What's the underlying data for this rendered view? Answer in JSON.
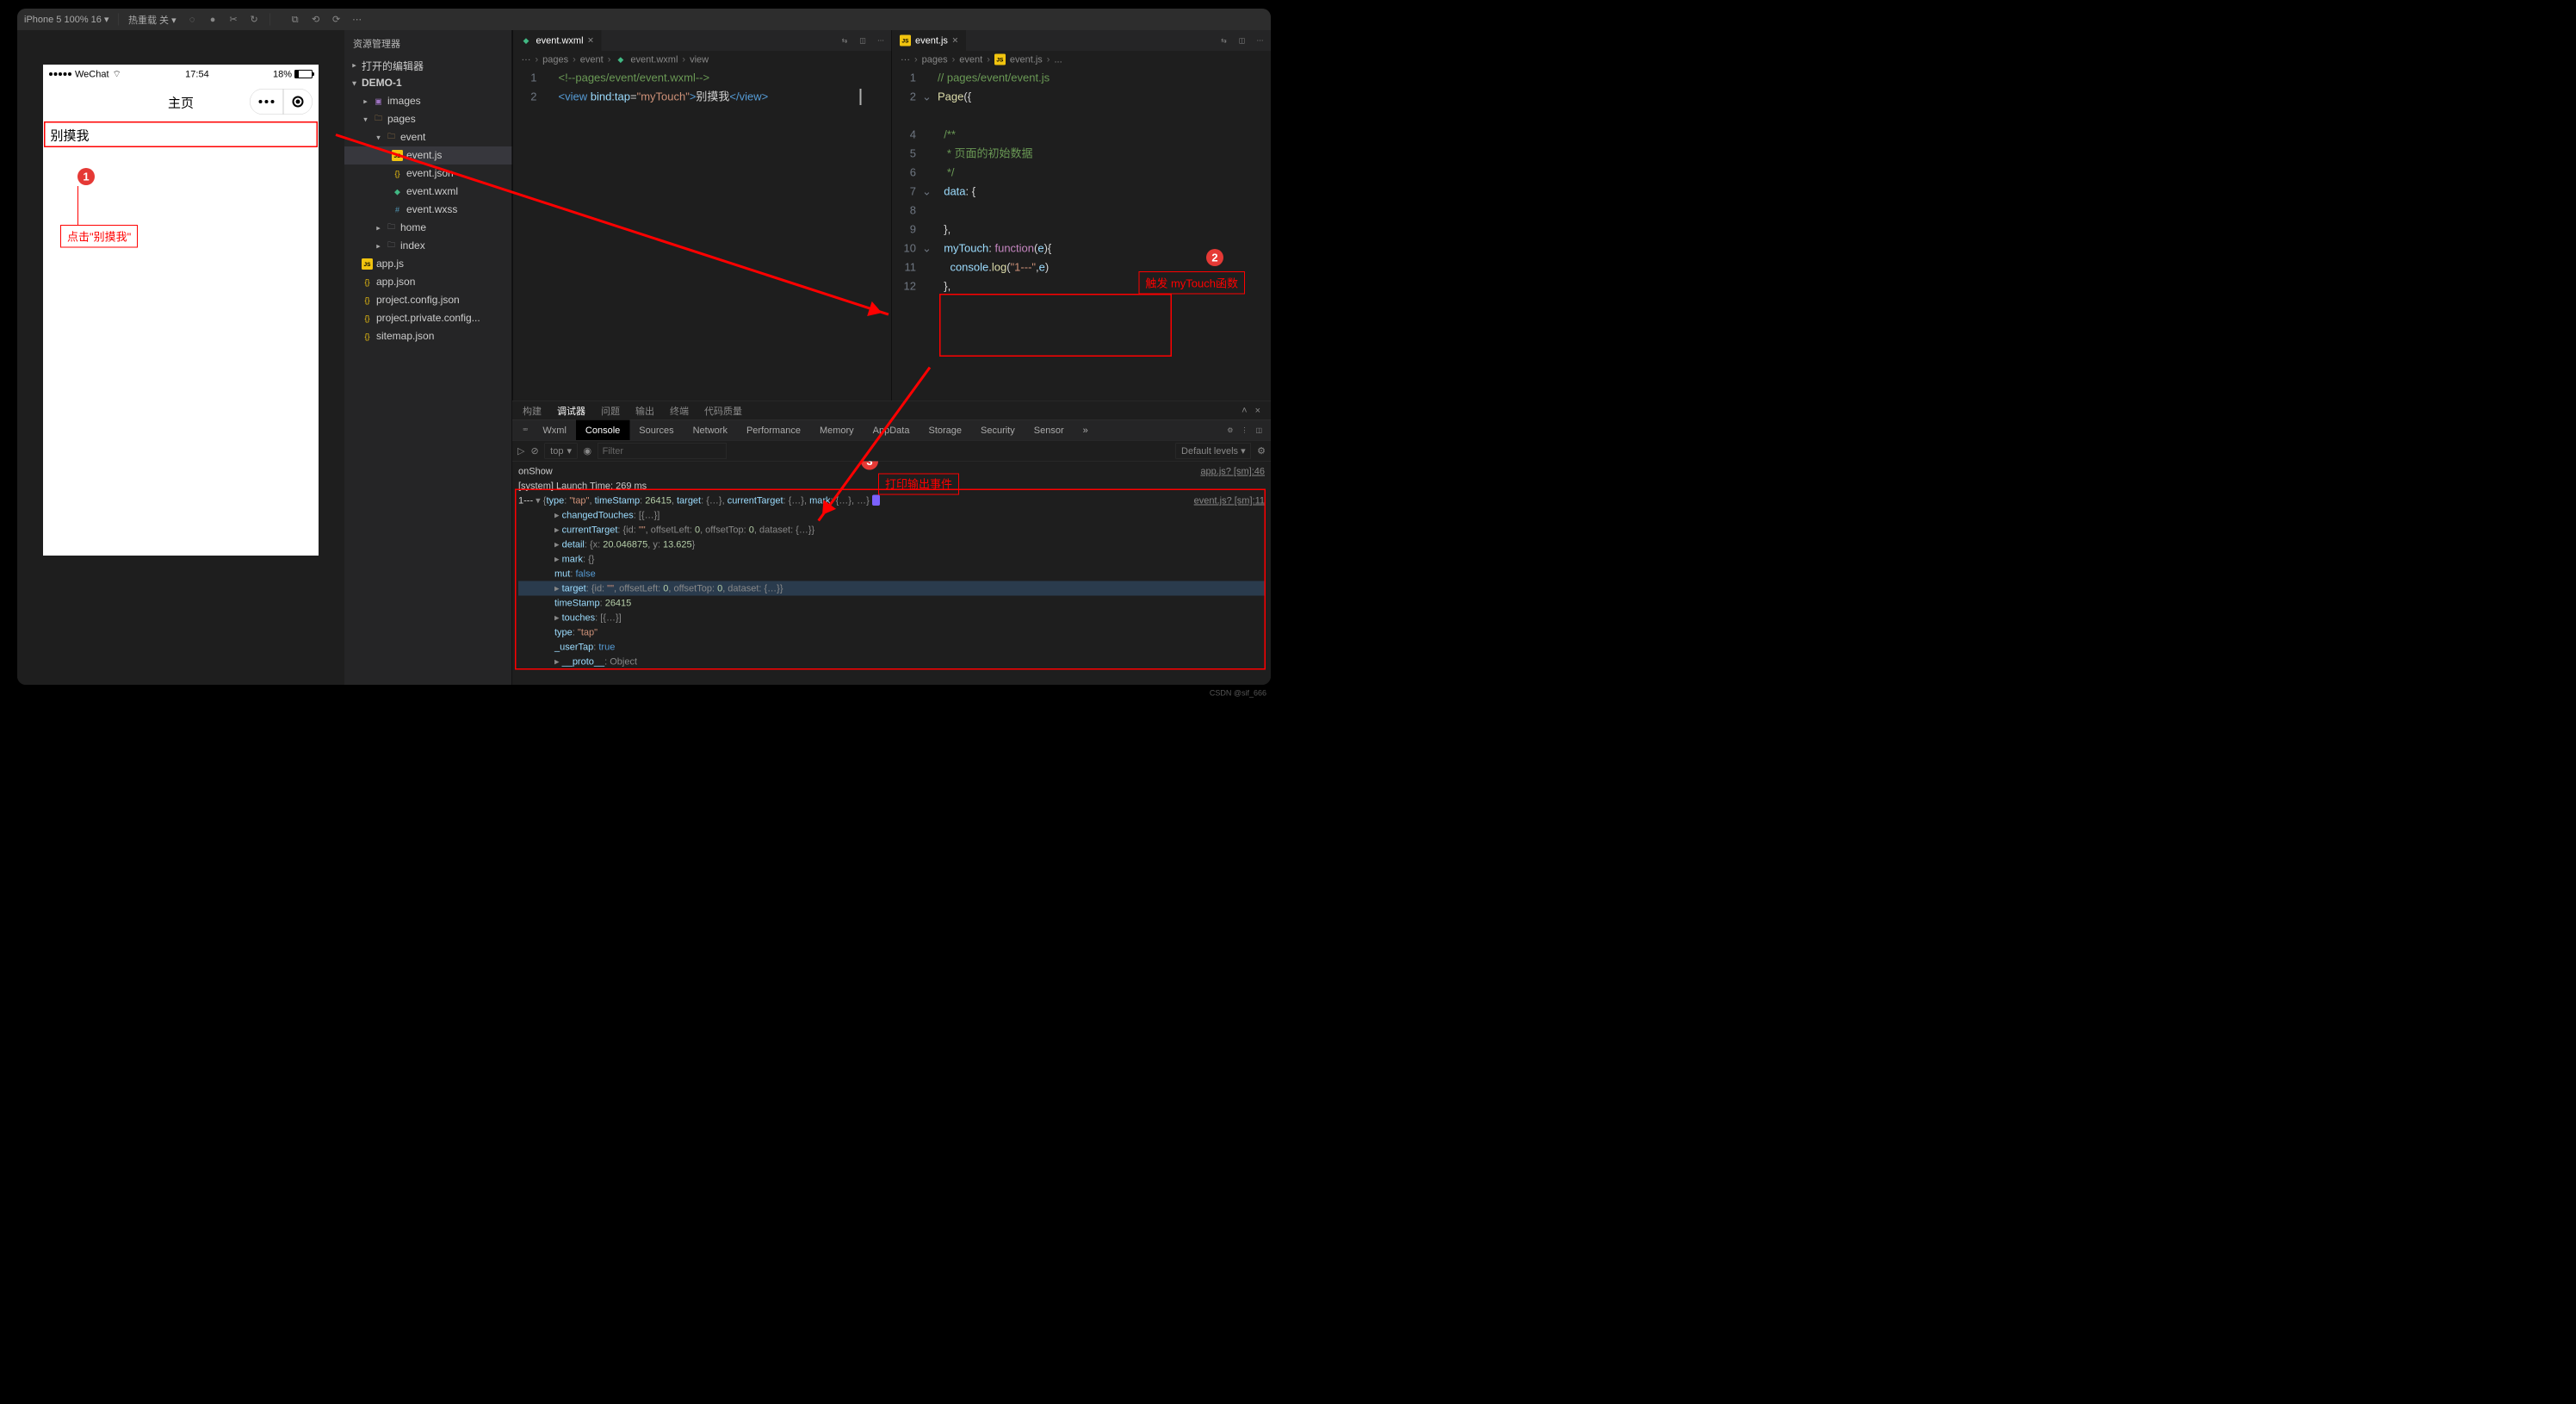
{
  "titlebar": {
    "device": "iPhone 5 100% 16 ▾",
    "hot_reload": "热重载 关 ▾"
  },
  "simulator": {
    "carrier": "WeChat",
    "time": "17:54",
    "battery": "18%",
    "page_title": "主页",
    "touch_text": "别摸我"
  },
  "annotations": {
    "a1": {
      "num": "1",
      "text": "点击\"别摸我\""
    },
    "a2": {
      "num": "2",
      "text": "触发 myTouch函数"
    },
    "a3": {
      "num": "3",
      "text": "打印输出事件"
    }
  },
  "explorer": {
    "title": "资源管理器",
    "open_editors": "打开的编辑器",
    "project": "DEMO-1",
    "tree": {
      "images": "images",
      "pages": "pages",
      "event": "event",
      "event_js": "event.js",
      "event_json": "event.json",
      "event_wxml": "event.wxml",
      "event_wxss": "event.wxss",
      "home": "home",
      "index": "index",
      "app_js": "app.js",
      "app_json": "app.json",
      "project_config": "project.config.json",
      "project_private": "project.private.config...",
      "sitemap": "sitemap.json"
    }
  },
  "left_editor": {
    "tab": "event.wxml",
    "crumbs": [
      "···",
      "pages",
      "event",
      "event.wxml",
      "view"
    ]
  },
  "right_editor": {
    "tab": "event.js",
    "crumbs": [
      "···",
      "pages",
      "event",
      "event.js",
      "..."
    ]
  },
  "panel": {
    "tabs": [
      "构建",
      "调试器",
      "问题",
      "输出",
      "终端",
      "代码质量"
    ],
    "dev_tabs": [
      "Wxml",
      "Console",
      "Sources",
      "Network",
      "Performance",
      "Memory",
      "AppData",
      "Storage",
      "Security",
      "Sensor"
    ],
    "top_ctx": "top",
    "filter_ph": "Filter",
    "levels": "Default levels ▾"
  },
  "console": {
    "onshow": "onShow",
    "onshow_src": "app.js? [sm]:46",
    "launch": "[system] Launch Time: 269 ms",
    "main_src": "event.js? [sm]:11",
    "prefix": "1---",
    "head": "{type: \"tap\", timeStamp: 26415, target: {…}, currentTarget: {…}, mark: {…}, …}",
    "changedTouches": "changedTouches: [{…}]",
    "currentTarget": "currentTarget: {id: \"\", offsetLeft: 0, offsetTop: 0, dataset: {…}}",
    "detail": "detail: {x: 20.046875, y: 13.625}",
    "mark": "mark: {}",
    "mut": "mut: false",
    "target": "target: {id: \"\", offsetLeft: 0, offsetTop: 0, dataset: {…}}",
    "timeStamp": "timeStamp: 26415",
    "touches": "touches: [{…}]",
    "type": "type: \"tap\"",
    "userTap": "_userTap: true",
    "proto": "__proto__: Object"
  },
  "watermark": "CSDN @sif_666"
}
